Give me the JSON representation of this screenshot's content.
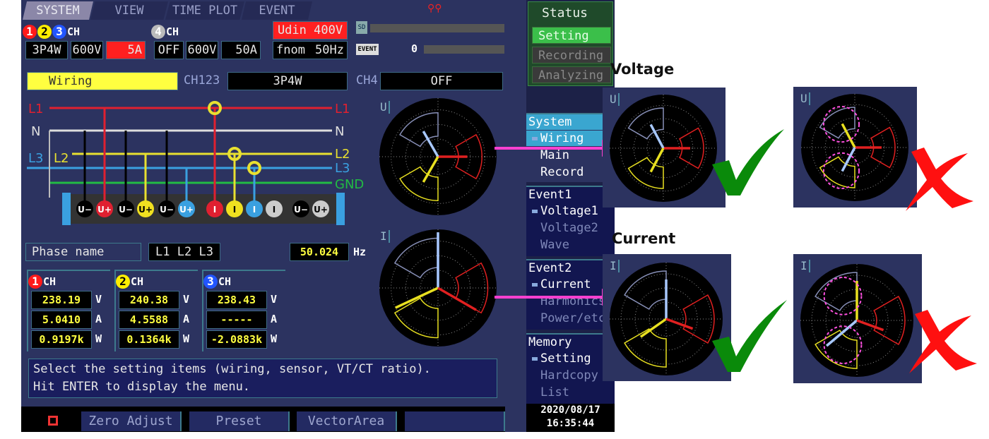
{
  "tabs": [
    "SYSTEM",
    "VIEW",
    "TIME PLOT",
    "EVENT"
  ],
  "ch123": {
    "label": "CH",
    "nums": [
      "1",
      "2",
      "3"
    ],
    "wiring": "3P4W",
    "voltage": "600V",
    "current": "5A"
  },
  "ch4": {
    "label": "CH",
    "num": "4",
    "wiring": "OFF",
    "voltage": "600V",
    "current": "50A"
  },
  "udin": "Udin 400V",
  "fnom": {
    "label": "fnom",
    "value": "50Hz"
  },
  "sd_label": "SD",
  "event": {
    "label": "EVENT",
    "count": "0"
  },
  "wiring_row": {
    "label": "Wiring",
    "ch123_label": "CH123",
    "ch123_value": "3P4W",
    "ch4_label": "CH4",
    "ch4_value": "OFF"
  },
  "diagram": {
    "left_labels": [
      "L1",
      "N",
      "L3",
      "L2"
    ],
    "right_labels": [
      "L1",
      "N",
      "L2",
      "L3",
      "GND"
    ],
    "terminals": [
      "U−",
      "U+",
      "U−",
      "U+",
      "U−",
      "U+",
      "I",
      "I",
      "I",
      "I",
      "U−",
      "U+"
    ]
  },
  "phase": {
    "label": "Phase name",
    "value": "L1 L2 L3"
  },
  "frequency": {
    "value": "50.024",
    "unit": "Hz"
  },
  "channels": [
    {
      "num": "1",
      "label": "CH",
      "v": "238.19",
      "a": "5.0410",
      "w": "0.9197k"
    },
    {
      "num": "2",
      "label": "CH",
      "v": "240.38",
      "a": "4.5588",
      "w": "0.1364k"
    },
    {
      "num": "3",
      "label": "CH",
      "v": "238.43",
      "a": "-----",
      "w": "-2.0883k"
    }
  ],
  "units": {
    "v": "V",
    "a": "A",
    "w": "W"
  },
  "message": [
    "Select the setting items (wiring, sensor, VT/CT ratio).",
    "Hit ENTER to display the menu."
  ],
  "footer": [
    "Zero Adjust",
    "Preset",
    "VectorArea",
    ""
  ],
  "status": {
    "title": "Status",
    "items": [
      "Setting",
      "Recording",
      "Analyzing"
    ],
    "active": "Setting"
  },
  "menu": [
    {
      "head": "System",
      "items": [
        "Wiring",
        "Main",
        "Record"
      ],
      "selected": "Wiring"
    },
    {
      "head": "Event1",
      "items": [
        "Voltage1",
        "Voltage2",
        "Wave"
      ],
      "selected": "Voltage1"
    },
    {
      "head": "Event2",
      "items": [
        "Current",
        "Harmonics",
        "Power/etc"
      ],
      "selected": "Current"
    },
    {
      "head": "Memory",
      "items": [
        "Setting",
        "Hardcopy",
        "List"
      ],
      "selected": "Setting"
    }
  ],
  "datetime": {
    "date": "2020/08/17",
    "time": "16:35:44"
  },
  "vector_labels": {
    "u": "U",
    "i": "I"
  },
  "annotations": {
    "voltage": "Voltage",
    "current": "Current",
    "correct": "check-mark",
    "wrong": "x-mark"
  },
  "colors": {
    "ch1": "#ff1a1a",
    "ch2": "#ffee00",
    "ch3": "#2255ff",
    "ch3_vector": "#a8c8ff",
    "gnd": "#22bb44",
    "arrow": "#ff40d0",
    "check": "#0a8a0a",
    "cross": "#ff1010"
  }
}
